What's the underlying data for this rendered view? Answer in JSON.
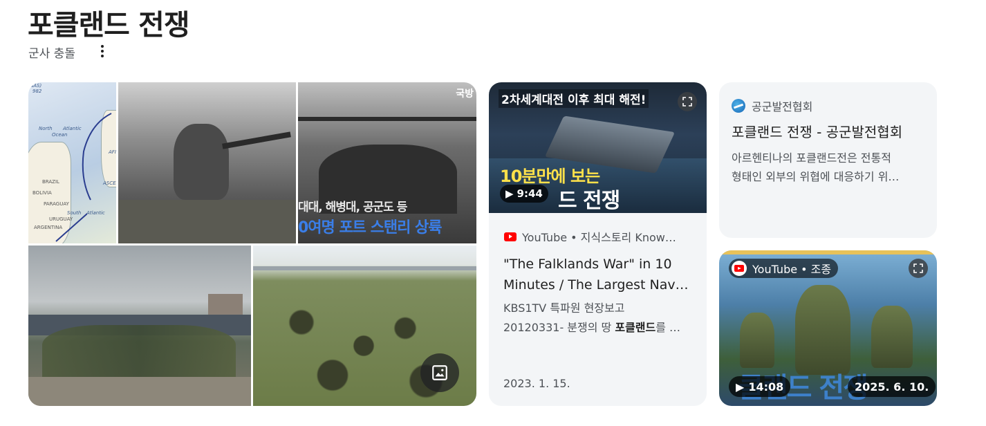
{
  "header": {
    "title": "포클랜드 전쟁",
    "subtitle": "군사 충돌"
  },
  "images": {
    "tile1_texts": [
      "NAS)",
      "982",
      "North",
      "Atlantic",
      "Ocean",
      "BRAZIL",
      "BOLIVIA",
      "PARAGUAY",
      "URUGUAY",
      "ARGENTINA",
      "South",
      "Atlantic",
      "ASCEN",
      "AFI"
    ],
    "tile3_texts": {
      "corner": "국방",
      "line1": "대대, 해병대, 공군도 등",
      "line2": "0여명 포트 스탠리 상륙"
    }
  },
  "video_card": {
    "thumb_top_text": "2차세계대전 이후 최대 해전!",
    "thumb_mid_text": "10분만에 보는",
    "thumb_bottom_text": "드 전쟁",
    "duration": "9:44",
    "source": "YouTube • 지식스토리 Know…",
    "title_line1": "\"The Falklands War\" in 10",
    "title_line2": "Minutes / The Largest Nav…",
    "desc_line1": "KBS1TV 특파원 현장보고",
    "desc_line2_prefix": "20120331- 분쟁의 땅 ",
    "desc_line2_bold": "포클랜드",
    "desc_line2_suffix": "를 …",
    "date": "2023. 1. 15."
  },
  "article_card": {
    "site": "공군발전협회",
    "title": "포클랜드 전쟁 - 공군발전협회",
    "desc_line1": "아르헨티나의 포클랜드전은 전통적",
    "desc_line2": "형태인 외부의 위협에 대응하기 위…"
  },
  "video_card2": {
    "source": "YouTube • 조종",
    "thumb_text": "클랜드 전쟁",
    "duration": "14:08",
    "date": "2025. 6. 10."
  },
  "colors": {
    "card_bg": "#f3f5f7",
    "youtube_red": "#ff0000",
    "text_primary": "#1f1f1f",
    "text_secondary": "#4d5156"
  },
  "icons": [
    "more-vert-icon",
    "image-icon",
    "play-icon",
    "expand-icon",
    "youtube-icon",
    "site-favicon"
  ]
}
